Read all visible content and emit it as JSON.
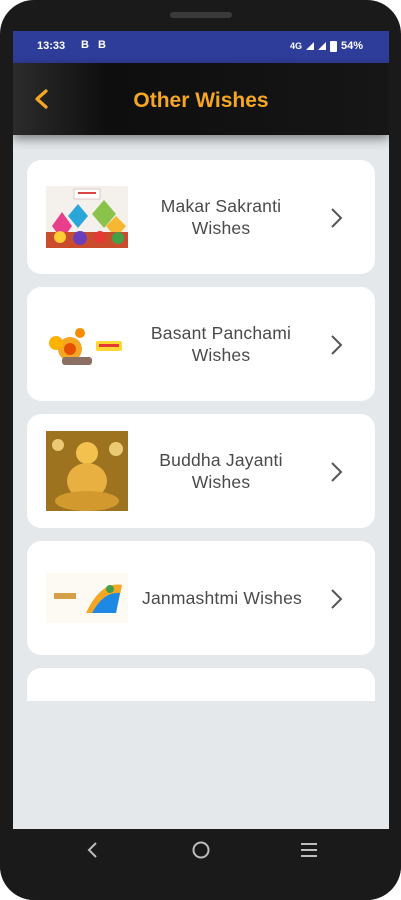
{
  "status_bar": {
    "time": "13:33",
    "notification_icons": "B B",
    "battery": "54%",
    "signal_label": "4G"
  },
  "app_bar": {
    "title": "Other Wishes",
    "back_icon": "chevron-left-icon",
    "title_color": "#f5a623"
  },
  "items": [
    {
      "label": "Makar Sakranti Wishes",
      "thumb": "kites-image"
    },
    {
      "label": "Basant Panchami Wishes",
      "thumb": "marigold-image"
    },
    {
      "label": "Buddha Jayanti Wishes",
      "thumb": "buddha-image"
    },
    {
      "label": "Janmashtmi Wishes",
      "thumb": "krishna-image"
    },
    {
      "label": "",
      "thumb": ""
    }
  ],
  "nav": {
    "back": "nav-back-icon",
    "home": "nav-home-icon",
    "recents": "nav-recents-icon"
  }
}
